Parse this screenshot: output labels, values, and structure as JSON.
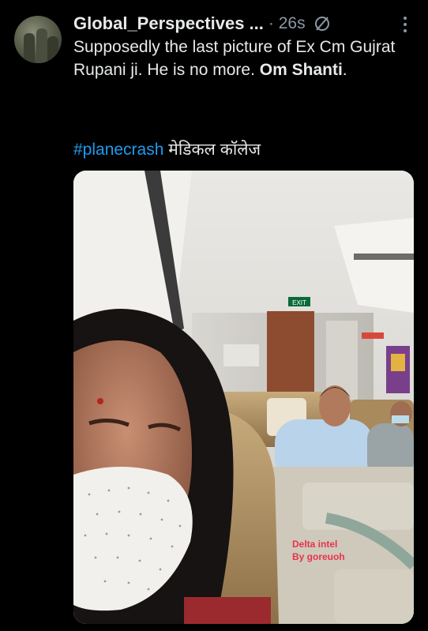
{
  "tweet": {
    "display_name": "Global_Perspectives ...",
    "time": "· 26s",
    "text_plain": "Supposedly the last picture of Ex Cm Gujrat Rupani ji. He is no more. ",
    "text_bold": "Om Shanti",
    "text_end": ".",
    "hashtag": "#planecrash",
    "hashtag_suffix": " मेडिकल कॉलेज"
  },
  "media": {
    "watermark_line1": "Delta intel",
    "watermark_line2": "By goreuoh",
    "exit_sign": "EXIT"
  },
  "icons": {
    "avatar": "avatar-image",
    "status": "no-entry-slash-icon",
    "menu": "more-vertical-icon"
  },
  "colors": {
    "background": "#000000",
    "text": "#e7e9ea",
    "muted": "#8b98a5",
    "link": "#1d9bf0"
  }
}
